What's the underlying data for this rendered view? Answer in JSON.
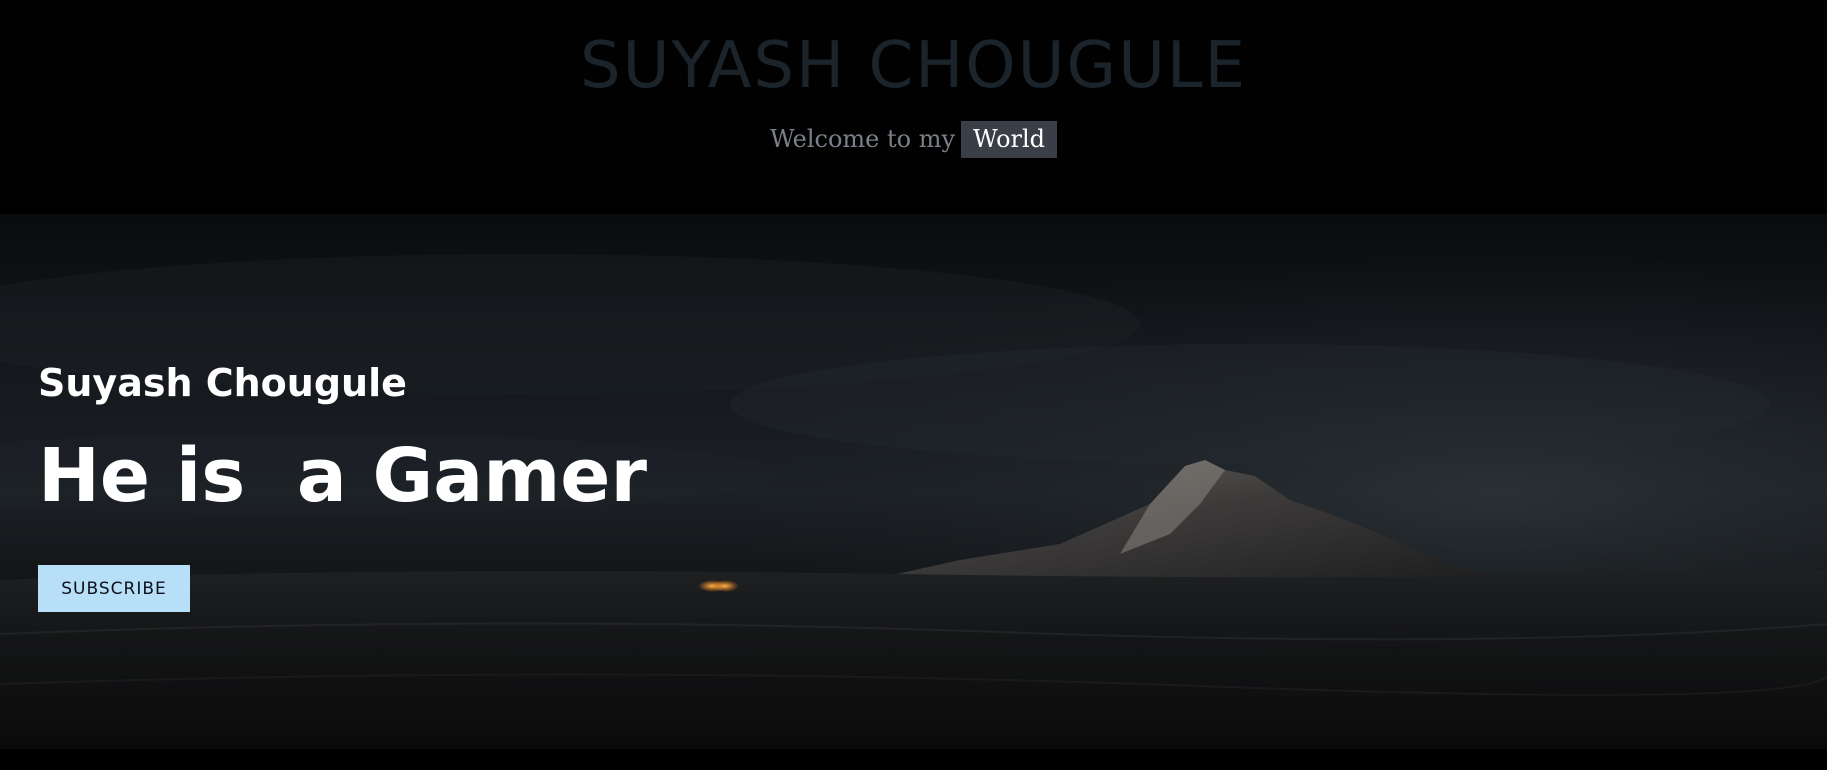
{
  "header": {
    "site_title": "SUYASH CHOUGULE",
    "tagline_prefix": "Welcome to my",
    "tagline_highlight": "World"
  },
  "hero": {
    "name": "Suyash Chougule",
    "headline": "He is  a Gamer",
    "subscribe_label": "SUBSCRIBE",
    "background_scene": "dark-desert-mountain-night",
    "colors": {
      "button_bg": "#b8dff8",
      "text": "#ffffff",
      "title_dim": "#1b232b",
      "highlight_bg": "#3a3f47"
    }
  }
}
